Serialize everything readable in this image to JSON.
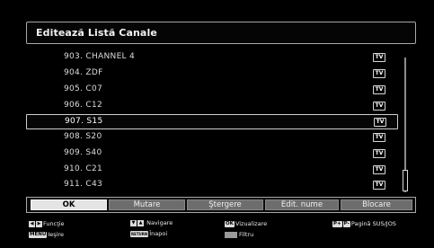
{
  "title": "Editează Listă Canale",
  "channels": [
    {
      "label": "903. CHANNEL 4",
      "badge": "TV"
    },
    {
      "label": "904. ZDF",
      "badge": "TV"
    },
    {
      "label": "905. C07",
      "badge": "TV"
    },
    {
      "label": "906. C12",
      "badge": "TV"
    },
    {
      "label": "907. S15",
      "badge": "TV"
    },
    {
      "label": "908. S20",
      "badge": "TV"
    },
    {
      "label": "909. S40",
      "badge": "TV"
    },
    {
      "label": "910. C21",
      "badge": "TV"
    },
    {
      "label": "911. C43",
      "badge": "TV"
    }
  ],
  "selected_channel": "907. S15",
  "buttons": {
    "ok": "OK",
    "move": "Mutare",
    "delete": "Ştergere",
    "edit_name": "Edit. nume",
    "lock": "Blocare"
  },
  "hints": {
    "function": "Funcţie",
    "navigate": "Navigare",
    "view": "Vizualizare",
    "page": "Pagină SUS/JOS",
    "exit": "Ieşire",
    "back": "Înapoi",
    "filter": "Filtru"
  },
  "keys": {
    "menu": "MENU",
    "ok": "OK",
    "return": "RETURN",
    "p_plus": "P+",
    "p_minus": "P-"
  }
}
